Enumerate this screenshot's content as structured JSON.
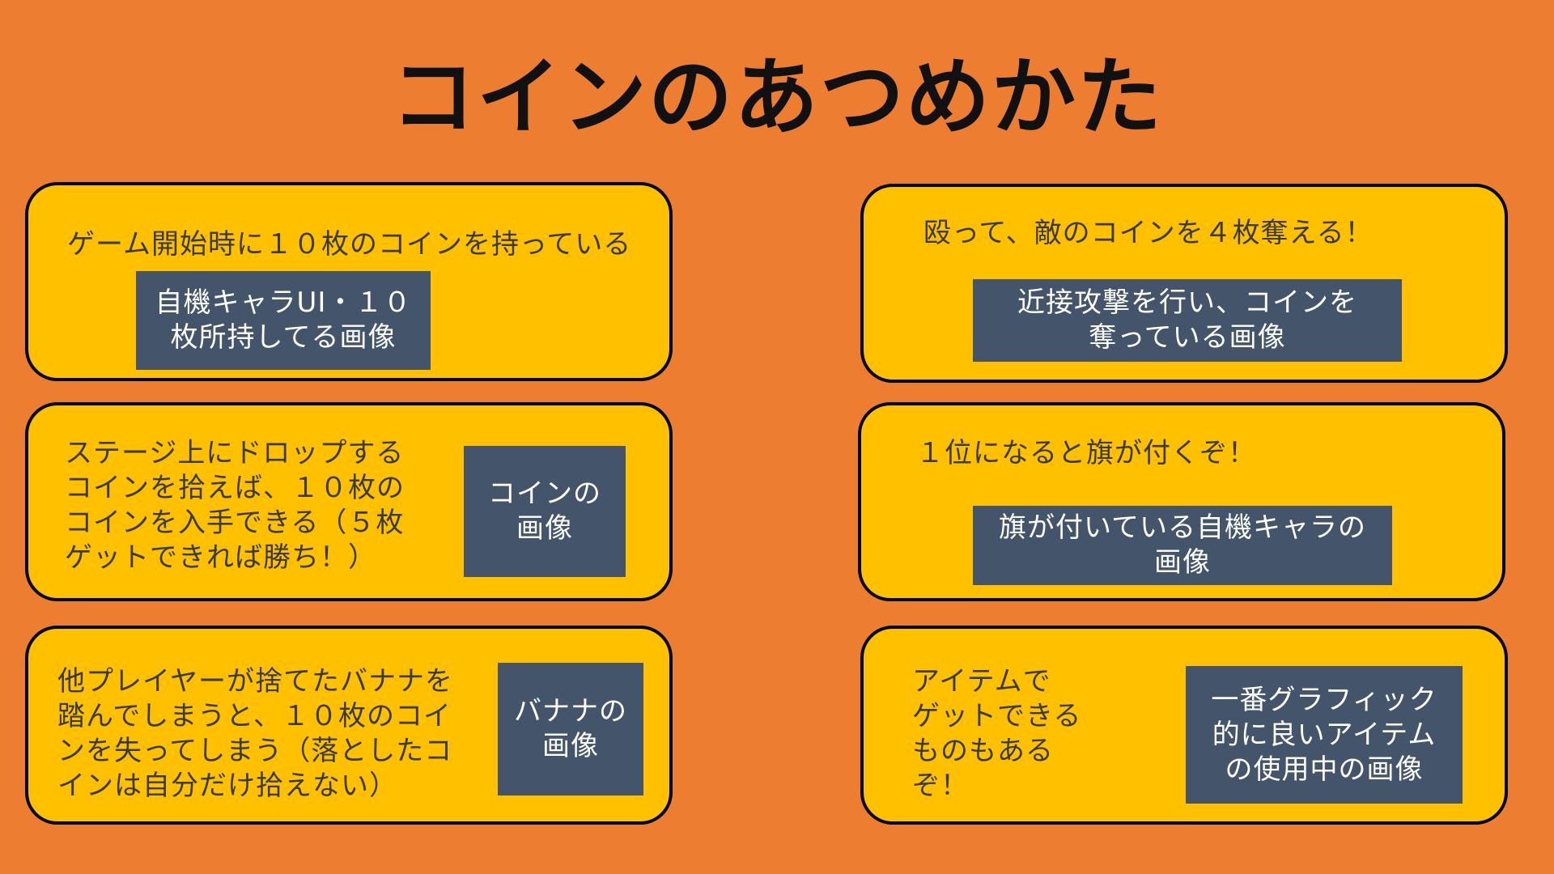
{
  "title": "コインのあつめかた",
  "colors": {
    "background": "#ED7D31",
    "card_fill": "#FFC000",
    "card_border": "#000000",
    "placeholder_fill": "#44546A",
    "placeholder_text": "#FFFFFF"
  },
  "cards": [
    {
      "text": "ゲーム開始時に１０枚のコインを持っている",
      "image_placeholder": "自機キャラUI・１０\n枚所持してる画像"
    },
    {
      "text": "殴って、敵のコインを４枚奪える！",
      "image_placeholder": "近接攻撃を行い、コインを\n奪っている画像"
    },
    {
      "text": "ステージ上にドロップする\nコインを拾えば、１０枚の\nコインを入手できる（５枚\nゲットできれば勝ち！）",
      "image_placeholder": "コインの\n画像"
    },
    {
      "text": "１位になると旗が付くぞ！",
      "image_placeholder": "旗が付いている自機キャラの\n画像"
    },
    {
      "text": "他プレイヤーが捨てたバナナを\n踏んでしまうと、１０枚のコイ\nンを失ってしまう（落としたコ\nインは自分だけ拾えない）",
      "image_placeholder": "バナナの\n画像"
    },
    {
      "text": "アイテムで\nゲットできる\nものもある\nぞ！",
      "image_placeholder": "一番グラフィック\n的に良いアイテム\nの使用中の画像"
    }
  ]
}
